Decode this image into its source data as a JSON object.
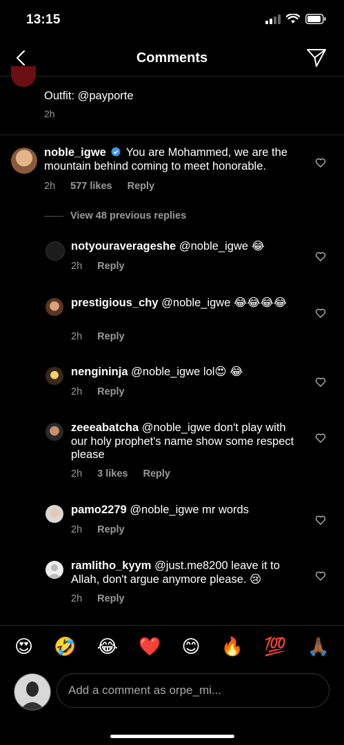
{
  "status_bar": {
    "time": "13:15"
  },
  "header": {
    "title": "Comments"
  },
  "top_comment": {
    "text": "Outfit: @payporte",
    "time": "2h"
  },
  "main_comment": {
    "username": "noble_igwe",
    "text": "You are Mohammed, we are the mountain behind coming to meet honorable.",
    "time": "2h",
    "likes": "577 likes",
    "reply": "Reply"
  },
  "view_replies": "View 48 previous replies",
  "replies": [
    {
      "username": "notyouraverageshe",
      "text": "@noble_igwe 😂",
      "time": "2h",
      "reply": "Reply"
    },
    {
      "username": "prestigious_chy",
      "text": "@noble_igwe 😂😂😂😂",
      "time": "2h",
      "reply": "Reply"
    },
    {
      "username": "nengininja",
      "text": "@noble_igwe lol😍 😂",
      "time": "2h",
      "reply": "Reply"
    },
    {
      "username": "zeeeabatcha",
      "text": "@noble_igwe don't play with our holy prophet's  name show some respect please",
      "time": "2h",
      "likes": "3 likes",
      "reply": "Reply"
    },
    {
      "username": "pamo2279",
      "text": "@noble_igwe mr words",
      "time": "2h",
      "reply": "Reply"
    },
    {
      "username": "ramlitho_kyym",
      "text": "@just.me8200 leave it to Allah, don't argue anymore please. 😢",
      "time": "2h",
      "reply": "Reply"
    }
  ],
  "emoji_bar": [
    "😍",
    "🤣",
    "😂",
    "❤️",
    "😊",
    "🔥",
    "💯",
    "🙏🏾"
  ],
  "composer": {
    "placeholder": "Add a comment as orpe_mi..."
  }
}
